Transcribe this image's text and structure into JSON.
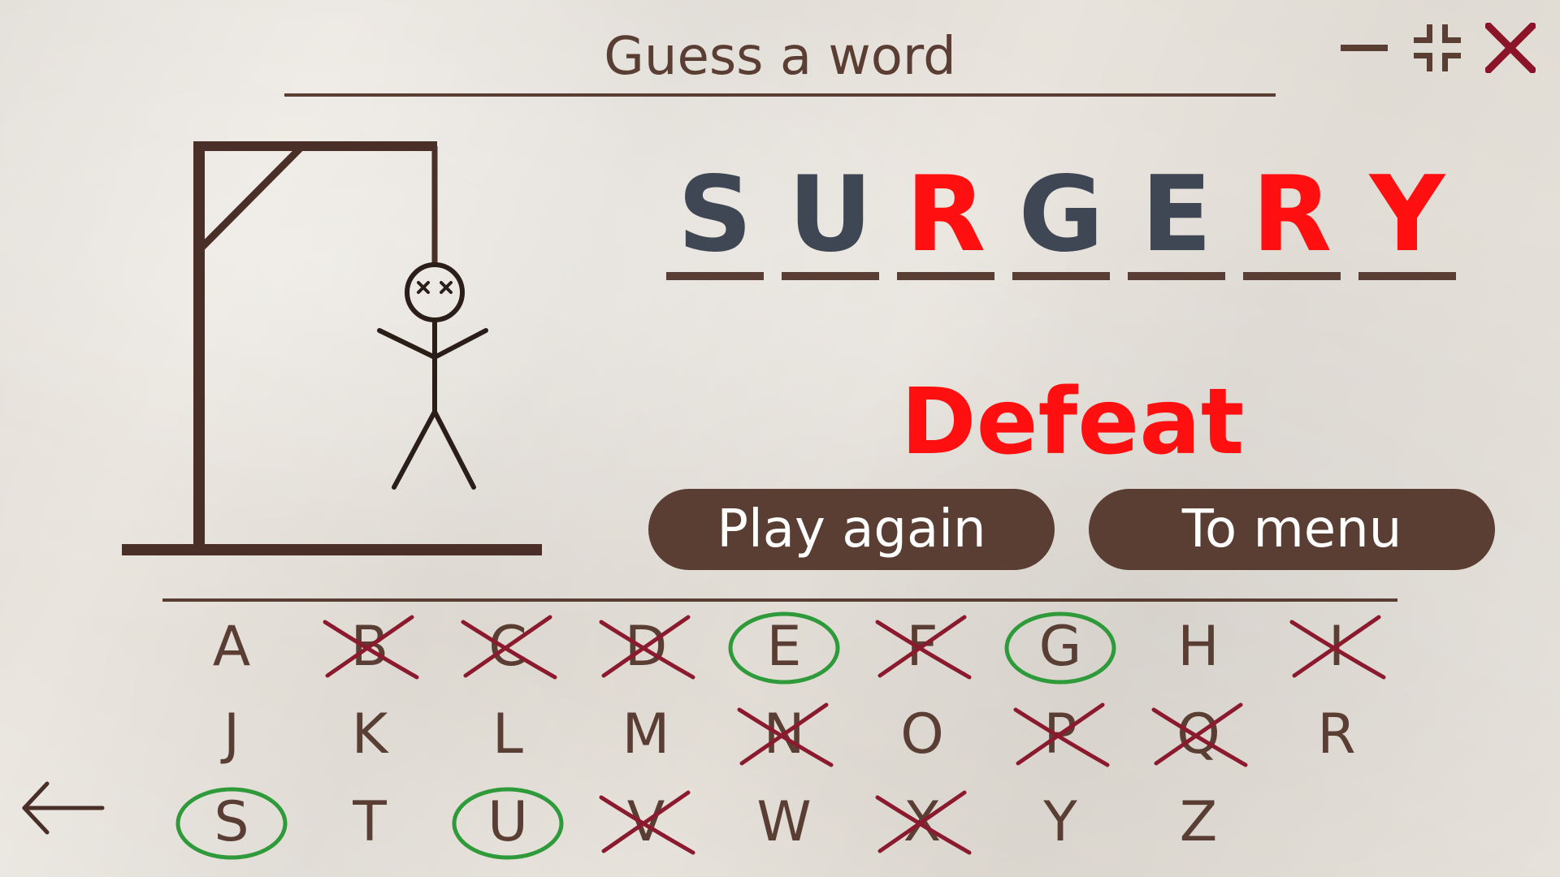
{
  "header": {
    "title": "Guess a word"
  },
  "window_controls": {
    "minimize_icon": "minimize-icon",
    "restore_icon": "restore-icon",
    "close_icon": "close-icon",
    "close_color": "#8b1428"
  },
  "word": {
    "letters": [
      {
        "char": "S",
        "status": "guessed"
      },
      {
        "char": "U",
        "status": "guessed"
      },
      {
        "char": "R",
        "status": "missed"
      },
      {
        "char": "G",
        "status": "guessed"
      },
      {
        "char": "E",
        "status": "guessed"
      },
      {
        "char": "R",
        "status": "missed"
      },
      {
        "char": "Y",
        "status": "missed"
      }
    ],
    "guessed_color": "#3f4654",
    "missed_color": "#ff0f0f"
  },
  "result": {
    "text": "Defeat",
    "color": "#ff0f0f"
  },
  "buttons": {
    "play_again": "Play again",
    "to_menu": "To menu"
  },
  "keyboard": {
    "rows": [
      [
        {
          "char": "A",
          "state": "unused"
        },
        {
          "char": "B",
          "state": "wrong"
        },
        {
          "char": "C",
          "state": "wrong"
        },
        {
          "char": "D",
          "state": "wrong"
        },
        {
          "char": "E",
          "state": "correct"
        },
        {
          "char": "F",
          "state": "wrong"
        },
        {
          "char": "G",
          "state": "correct"
        },
        {
          "char": "H",
          "state": "unused"
        },
        {
          "char": "I",
          "state": "wrong"
        }
      ],
      [
        {
          "char": "J",
          "state": "unused"
        },
        {
          "char": "K",
          "state": "unused"
        },
        {
          "char": "L",
          "state": "unused"
        },
        {
          "char": "M",
          "state": "unused"
        },
        {
          "char": "N",
          "state": "wrong"
        },
        {
          "char": "O",
          "state": "unused"
        },
        {
          "char": "P",
          "state": "wrong"
        },
        {
          "char": "Q",
          "state": "wrong"
        },
        {
          "char": "R",
          "state": "unused"
        }
      ],
      [
        {
          "char": "S",
          "state": "correct"
        },
        {
          "char": "T",
          "state": "unused"
        },
        {
          "char": "U",
          "state": "correct"
        },
        {
          "char": "V",
          "state": "wrong"
        },
        {
          "char": "W",
          "state": "unused"
        },
        {
          "char": "X",
          "state": "wrong"
        },
        {
          "char": "Y",
          "state": "unused"
        },
        {
          "char": "Z",
          "state": "unused"
        }
      ]
    ],
    "wrong_mark_color": "#8b1a2e",
    "correct_mark_color": "#2e9a3a"
  },
  "navigation": {
    "back_icon": "back-arrow-icon"
  },
  "colors": {
    "ink": "#5a3e34",
    "paper": "#e6e1d9"
  }
}
